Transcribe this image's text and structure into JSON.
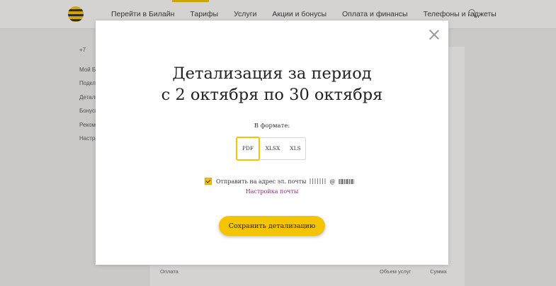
{
  "header": {
    "nav": [
      "Перейти в Билайн",
      "Тарифы",
      "Услуги",
      "Акции и бонусы",
      "Оплата и финансы",
      "Телефоны и гаджеты"
    ]
  },
  "sidebar": {
    "phone": "+7",
    "items": [
      "Мой Билайн",
      "Подключённые",
      "Детализация",
      "Бонусы",
      "Рекомендации",
      "Настройки"
    ]
  },
  "table": {
    "col1": "Оплата",
    "col2": "Объем услуг",
    "col3": "Сумма"
  },
  "modal": {
    "title_line1": "Детализация за период",
    "title_line2": "с 2 октября по 30 октября",
    "format_label": "В формате:",
    "formats": [
      "PDF",
      "XLSX",
      "XLS"
    ],
    "selected_format": "PDF",
    "email_label": "Отправить на адрес эл. почты",
    "email_at": "@",
    "email_checked": true,
    "settings_link": "Настройка почты",
    "save_label": "Сохранить детализацию"
  },
  "colors": {
    "accent": "#f5c400",
    "link": "#8a2a7a"
  }
}
